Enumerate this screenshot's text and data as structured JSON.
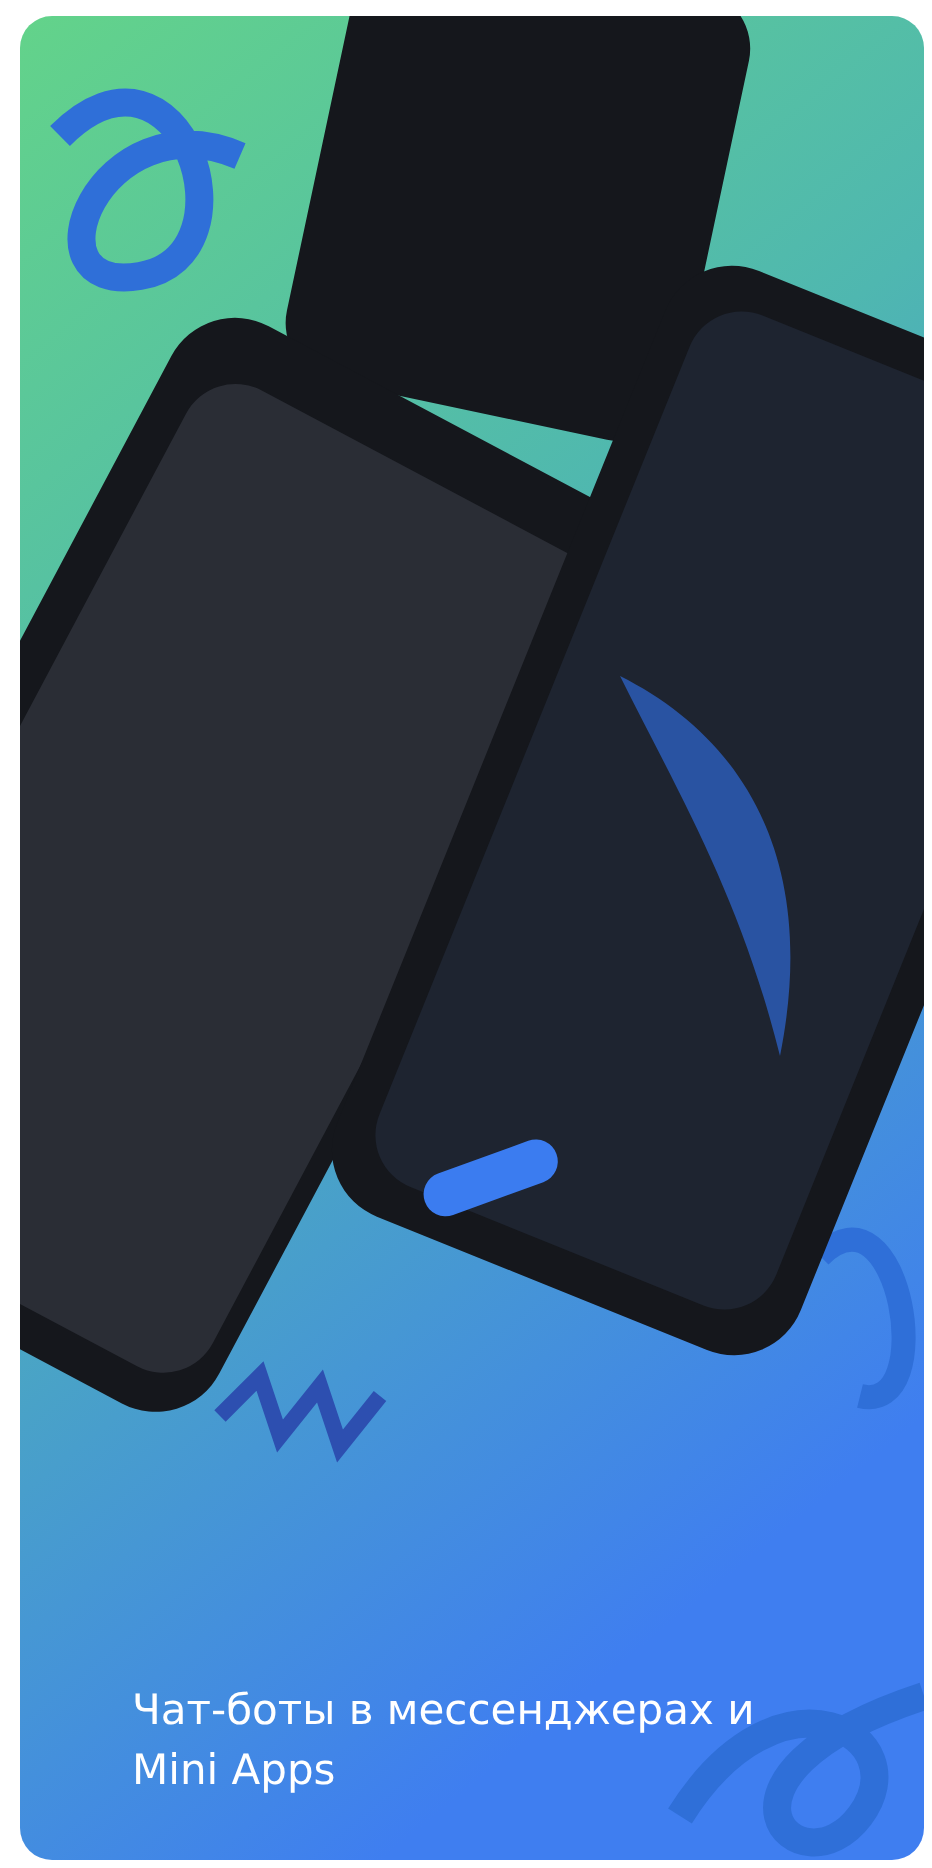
{
  "card": {
    "caption": "Чат-боты в мессенджерах и Mini Apps"
  }
}
